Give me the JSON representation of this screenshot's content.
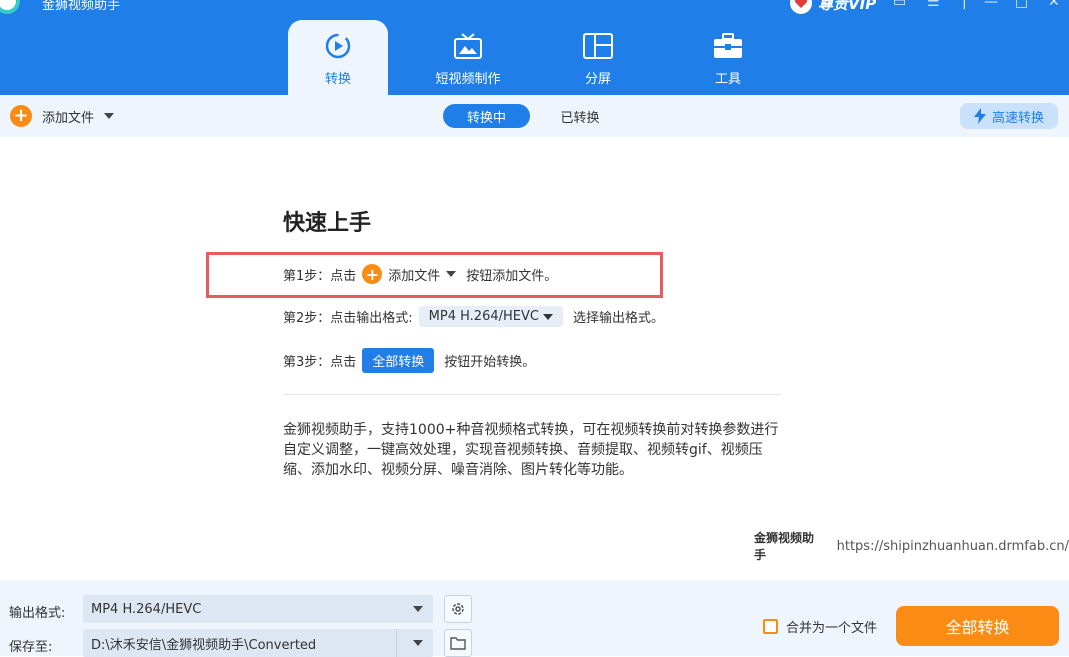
{
  "window": {
    "title": "金狮视频助手"
  },
  "header": {
    "vip_label": "尊贵VIP",
    "tabs": [
      {
        "label": "转换",
        "icon": "convert-icon"
      },
      {
        "label": "短视频制作",
        "icon": "tv-icon"
      },
      {
        "label": "分屏",
        "icon": "split-screen-icon"
      },
      {
        "label": "工具",
        "icon": "toolbox-icon"
      }
    ]
  },
  "toolbar": {
    "add_file_label": "添加文件",
    "segments": [
      "转换中",
      "已转换"
    ],
    "speed_label": "高速转换"
  },
  "main": {
    "title": "快速上手",
    "step1": {
      "prefix": "第1步：点击",
      "button": "添加文件",
      "suffix": "按钮添加文件。"
    },
    "step2": {
      "prefix": "第2步：点击输出格式:",
      "format": "MP4 H.264/HEVC",
      "suffix": "选择输出格式。"
    },
    "step3": {
      "prefix": "第3步：点击",
      "button": "全部转换",
      "suffix": "按钮开始转换。"
    },
    "description": "金狮视频助手，支持1000+种音视频格式转换，可在视频转换前对转换参数进行自定义调整，一键高效处理，实现音视频转换、音频提取、视频转gif、视频压缩、添加水印、视频分屏、噪音消除、图片转化等功能。",
    "brand_name": "金狮视频助手",
    "brand_url": "https://shipinzhuanhuan.drmfab.cn/"
  },
  "bottom": {
    "output_format_label": "输出格式:",
    "output_format_value": "MP4 H.264/HEVC",
    "save_to_label": "保存至:",
    "save_to_value": "D:\\沐禾安信\\金狮视频助手\\Converted",
    "merge_label": "合并为一个文件",
    "convert_all_label": "全部转换"
  },
  "colors": {
    "primary": "#1f7ee8",
    "accent": "#fa8c16",
    "highlight": "#e55d62"
  }
}
